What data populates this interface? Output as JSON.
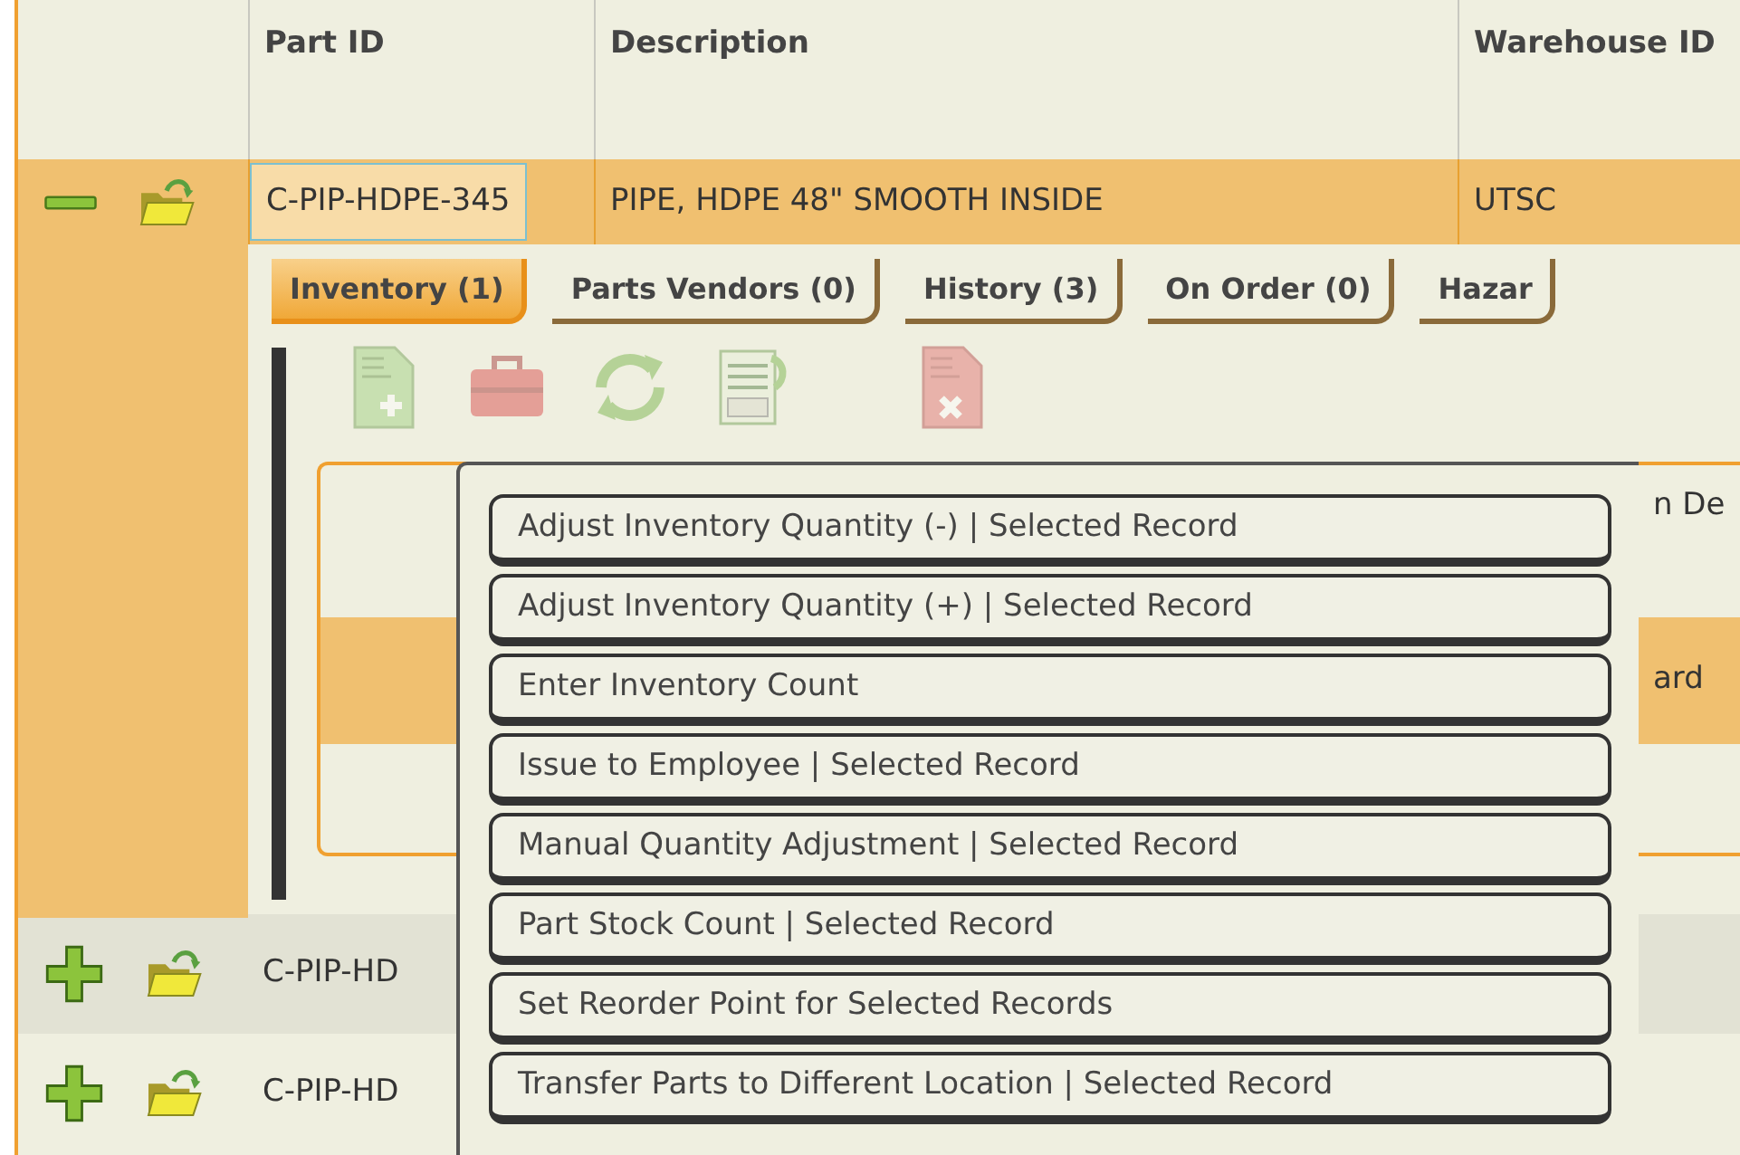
{
  "table": {
    "columns": [
      "Part ID",
      "Description",
      "Warehouse ID"
    ],
    "rows": [
      {
        "expanded": true,
        "selected": true,
        "cells": [
          "C-PIP-HDPE-345",
          "PIPE, HDPE 48\" SMOOTH INSIDE",
          "UTSC"
        ],
        "detail": {
          "tabs": [
            {
              "label": "Inventory (1)",
              "selected": true
            },
            {
              "label": "Parts Vendors (0)",
              "selected": false
            },
            {
              "label": "History (3)",
              "selected": false
            },
            {
              "label": "On Order (0)",
              "selected": false
            },
            {
              "label": "Hazar",
              "selected": false
            }
          ],
          "toolbar": [
            {
              "kind": "add",
              "disabled": true
            },
            {
              "kind": "toolbox",
              "disabled": true
            },
            {
              "kind": "refresh",
              "disabled": true
            },
            {
              "kind": "csv",
              "disabled": true
            },
            {
              "kind": "delete",
              "disabled": true
            }
          ],
          "inner_table": {
            "columns": [
              "n De"
            ],
            "rows": [
              {
                "selected": true,
                "cells": [
                  "ard"
                ]
              },
              {
                "selected": false
              }
            ]
          }
        }
      },
      {
        "expanded": false,
        "selected": false,
        "highlighted": true,
        "cells": [
          "C-PIP-HD"
        ]
      },
      {
        "expanded": false,
        "selected": false,
        "highlighted": false,
        "cells": [
          "C-PIP-HD"
        ]
      }
    ]
  },
  "context_menu": {
    "items": [
      "Adjust Inventory Quantity (-) | Selected Record",
      "Adjust Inventory Quantity (+) | Selected Record",
      "Enter Inventory Count",
      "Issue to Employee | Selected Record",
      "Manual Quantity Adjustment | Selected Record",
      "Part Stock Count | Selected Record",
      "Set Reorder Point for Selected Records",
      "Transfer Parts to Different Location | Selected Record"
    ]
  }
}
